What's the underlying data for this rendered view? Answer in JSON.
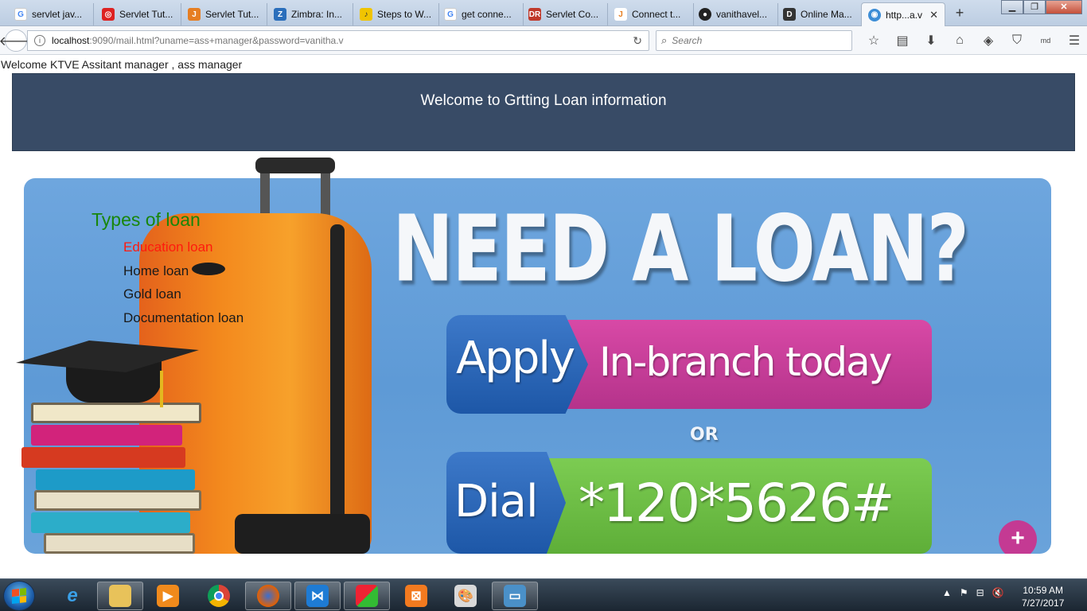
{
  "browser": {
    "tabs": [
      {
        "label": "servlet jav...",
        "icon": "google-icon",
        "color": "#4285f4"
      },
      {
        "label": "Servlet Tut...",
        "icon": "opera-icon",
        "color": "#d22"
      },
      {
        "label": "Servlet Tut...",
        "icon": "javatpoint-icon",
        "color": "#e67e22"
      },
      {
        "label": "Zimbra: In...",
        "icon": "zimbra-icon",
        "color": "#2a6ebb"
      },
      {
        "label": "Steps to W...",
        "icon": "steps-icon",
        "color": "#f0c400"
      },
      {
        "label": "get conne...",
        "icon": "google-icon",
        "color": "#4285f4"
      },
      {
        "label": "Servlet Co...",
        "icon": "dr-icon",
        "color": "#c0392b"
      },
      {
        "label": "Connect t...",
        "icon": "connect-icon",
        "color": "#e67e22"
      },
      {
        "label": "vanithavel...",
        "icon": "github-icon",
        "color": "#222"
      },
      {
        "label": "Online Ma...",
        "icon": "d-icon",
        "color": "#333"
      },
      {
        "label": "http...a.v",
        "icon": "page-icon",
        "color": "#3c8dd6",
        "active": true
      }
    ],
    "url_host": "localhost",
    "url_rest": ":9090/mail.html?uname=ass+manager&password=vanitha.v",
    "search_placeholder": "Search",
    "profile_label": "md"
  },
  "page": {
    "welcome_user": "Welcome KTVE Assitant manager , ass manager",
    "header_title": "Welcome to Grtting Loan information",
    "loan_menu": {
      "title": "Types of loan",
      "items": [
        {
          "label": "Education loan",
          "active": true
        },
        {
          "label": "Home loan"
        },
        {
          "label": "Gold loan"
        },
        {
          "label": "Documentation loan"
        }
      ]
    },
    "banner": {
      "headline": "NEED A LOAN?",
      "apply": "Apply",
      "in_branch": "In-branch today",
      "or": "OR",
      "dial": "Dial",
      "number": "*120*5626#"
    }
  },
  "taskbar": {
    "time": "10:59 AM",
    "date": "7/27/2017"
  },
  "colors": {
    "header_bg": "#384b66",
    "loan_title": "#18860a",
    "loan_active": "#ff1a0e"
  }
}
